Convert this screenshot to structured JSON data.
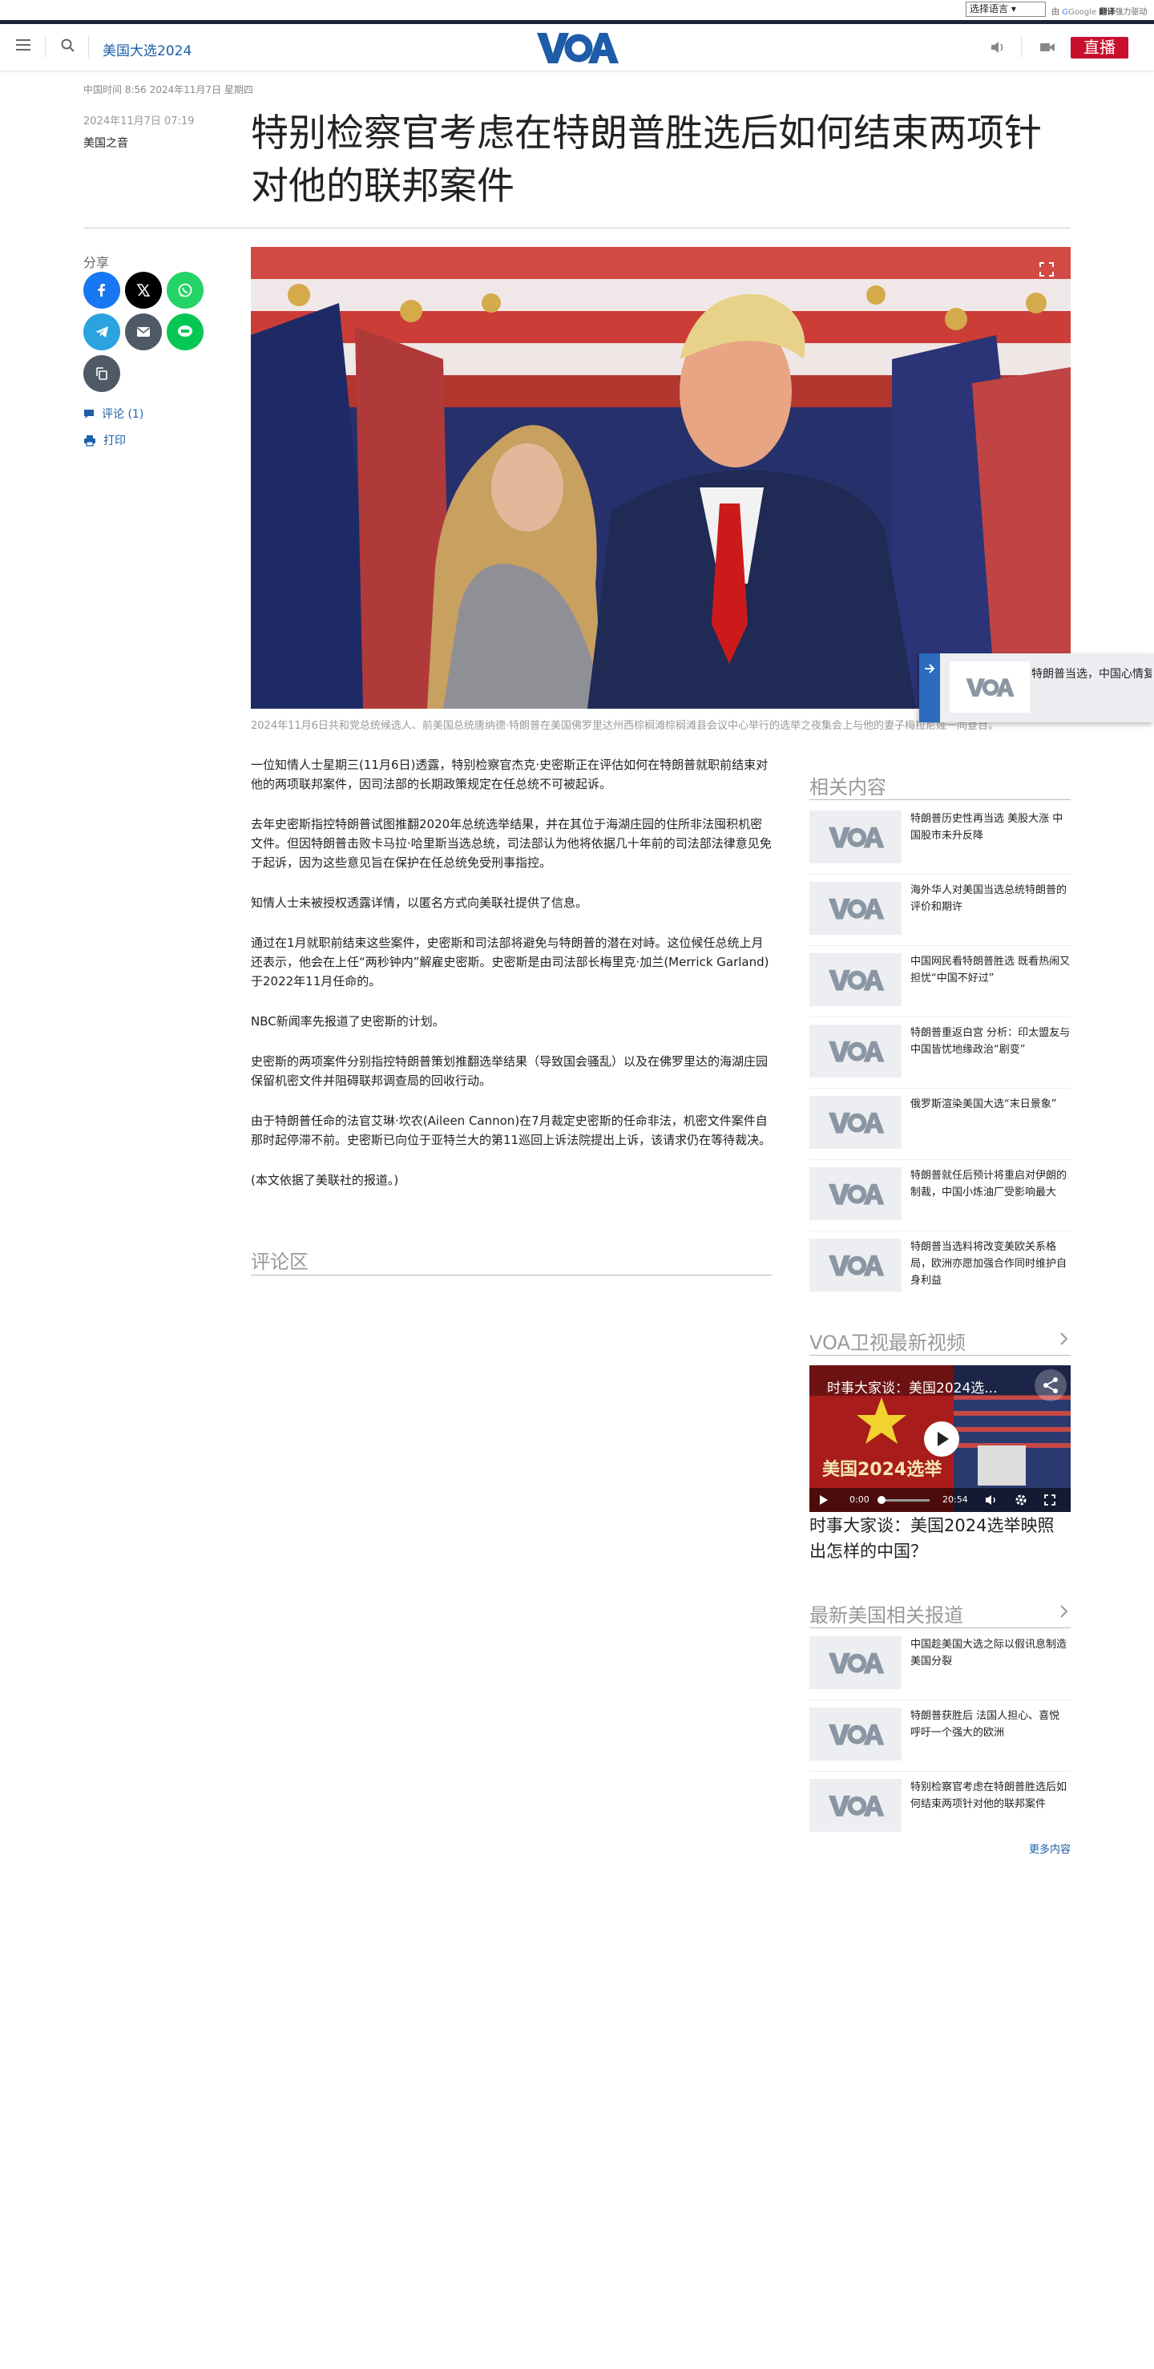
{
  "translate": {
    "select_label": "选择语言",
    "powered_by": "由",
    "google": "Google",
    "translate_word": "翻译",
    "power_suffix": "强力驱动"
  },
  "header": {
    "section": "美国大选2024",
    "live_label": "直播"
  },
  "article": {
    "dateline": "中国时间 8:56 2024年11月7日 星期四",
    "pubdate": "2024年11月7日 07:19",
    "source": "美国之音",
    "title": "特别检察官考虑在特朗普胜选后如何结束两项针对他的联邦案件",
    "caption": "2024年11月6日共和党总统候选人、前美国总统唐纳德·特朗普在美国佛罗里达州西棕榈滩棕榈滩县会议中心举行的选举之夜集会上与他的妻子梅拉尼娅一同登台。",
    "paragraphs": [
      "一位知情人士星期三(11月6日)透露，特别检察官杰克·史密斯正在评估如何在特朗普就职前结束对他的两项联邦案件，因司法部的长期政策规定在任总统不可被起诉。",
      "去年史密斯指控特朗普试图推翻2020年总统选举结果，并在其位于海湖庄园的住所非法囤积机密文件。但因特朗普击败卡马拉·哈里斯当选总统，司法部认为他将依据几十年前的司法部法律意见免于起诉，因为这些意见旨在保护在任总统免受刑事指控。",
      "知情人士未被授权透露详情，以匿名方式向美联社提供了信息。",
      "通过在1月就职前结束这些案件，史密斯和司法部将避免与特朗普的潜在对峙。这位候任总统上月还表示，他会在上任“两秒钟内”解雇史密斯。史密斯是由司法部长梅里克·加兰(Merrick Garland)于2022年11月任命的。",
      "NBC新闻率先报道了史密斯的计划。",
      "史密斯的两项案件分别指控特朗普策划推翻选举结果（导致国会骚乱）以及在佛罗里达的海湖庄园保留机密文件并阻碍联邦调查局的回收行动。",
      "由于特朗普任命的法官艾琳·坎农(Aileen Cannon)在7月裁定史密斯的任命非法，机密文件案件自那时起停滞不前。史密斯已向位于亚特兰大的第11巡回上诉法院提出上诉，该请求仍在等待裁决。",
      "(本文依据了美联社的报道。)"
    ]
  },
  "share": {
    "label": "分享",
    "comments": "评论 (1)",
    "print": "打印"
  },
  "floating": {
    "text": "特朗普当选，中国心情复杂，美中竞争或更加激烈"
  },
  "comments_title": "评论区",
  "related": {
    "title": "相关内容",
    "items": [
      "特朗普历史性再当选 美股大涨 中国股市未升反降",
      "海外华人对美国当选总统特朗普的评价和期许",
      "中国网民看特朗普胜选 既看热闹又担忧“中国不好过”",
      "特朗普重返白宫 分析：印太盟友与中国皆忧地缘政治“剧变”",
      "俄罗斯渲染美国大选“末日景象”",
      "特朗普就任后预计将重启对伊朗的制裁，中国小炼油厂受影响最大",
      "特朗普当选料将改变美欧关系格局，欧洲亦愿加强合作同时维护自身利益"
    ]
  },
  "videos": {
    "title": "VOA卫视最新视频",
    "overlay_title": "时事大家谈：美国2024选...",
    "thumb_text": "美国2024选举",
    "time_current": "0:00",
    "time_total": "20:54",
    "caption": "时事大家谈：美国2024选举映照出怎样的中国？"
  },
  "latest": {
    "title": "最新美国相关报道",
    "items": [
      "中国趁美国大选之际以假讯息制造美国分裂",
      "特朗普获胜后 法国人担心、喜悦 呼吁一个强大的欧洲",
      "特别检察官考虑在特朗普胜选后如何结束两项针对他的联邦案件"
    ],
    "more": "更多内容"
  }
}
